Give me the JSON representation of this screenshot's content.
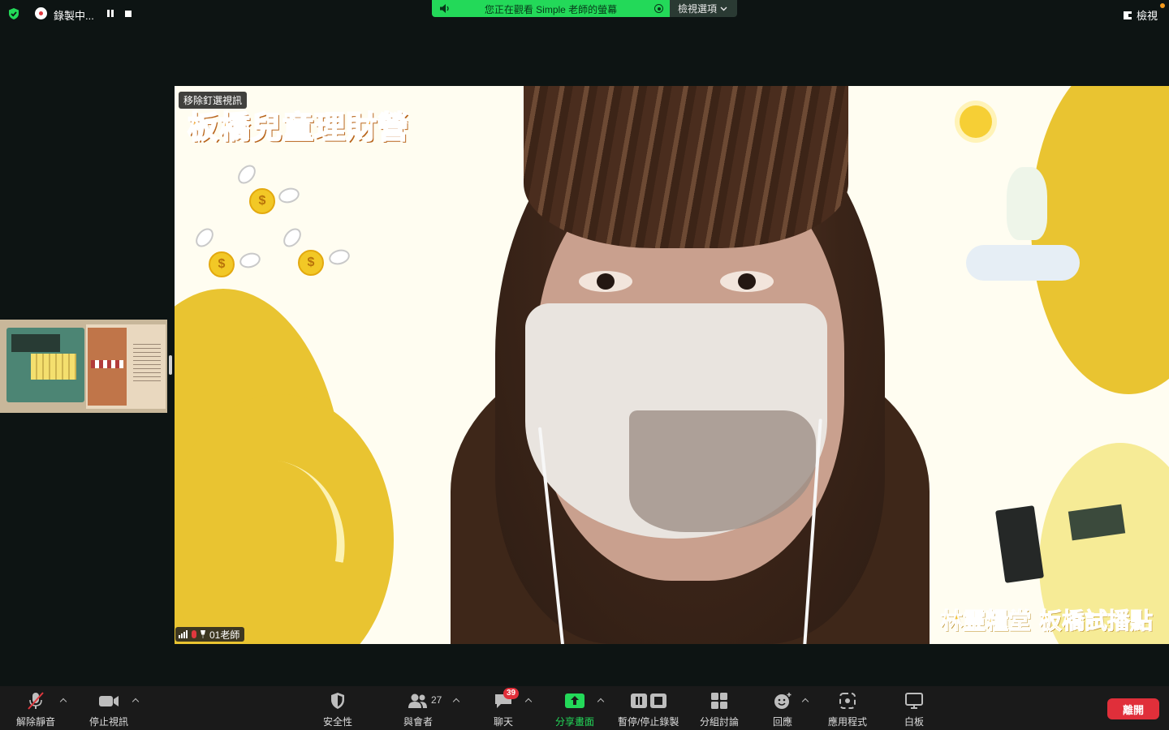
{
  "recording": {
    "status_text": "錄製中..."
  },
  "banner": {
    "text": "您正在觀看 Simple 老師的螢幕",
    "view_options": "檢視選項"
  },
  "top_right": {
    "view_label": "檢視"
  },
  "video": {
    "unpin_label": "移除釘選視訊",
    "title_overlay": "板橋兒童理財營",
    "footer_overlay": "林靈糧堂 板橋試播點",
    "participant_name": "01老師"
  },
  "toolbar": {
    "unmute": "解除靜音",
    "stop_video": "停止視訊",
    "security": "安全性",
    "participants": "與會者",
    "participants_count": "27",
    "chat": "聊天",
    "chat_badge": "39",
    "share_screen": "分享畫面",
    "pause_stop_record": "暫停/停止錄製",
    "breakout_rooms": "分組討論",
    "reactions": "回應",
    "apps": "應用程式",
    "whiteboard": "白板",
    "leave": "離開"
  },
  "colors": {
    "share_green": "#23d959",
    "leave_red": "#e02f3a",
    "badge_red": "#e02f3a",
    "recording_red": "#e0383e"
  }
}
